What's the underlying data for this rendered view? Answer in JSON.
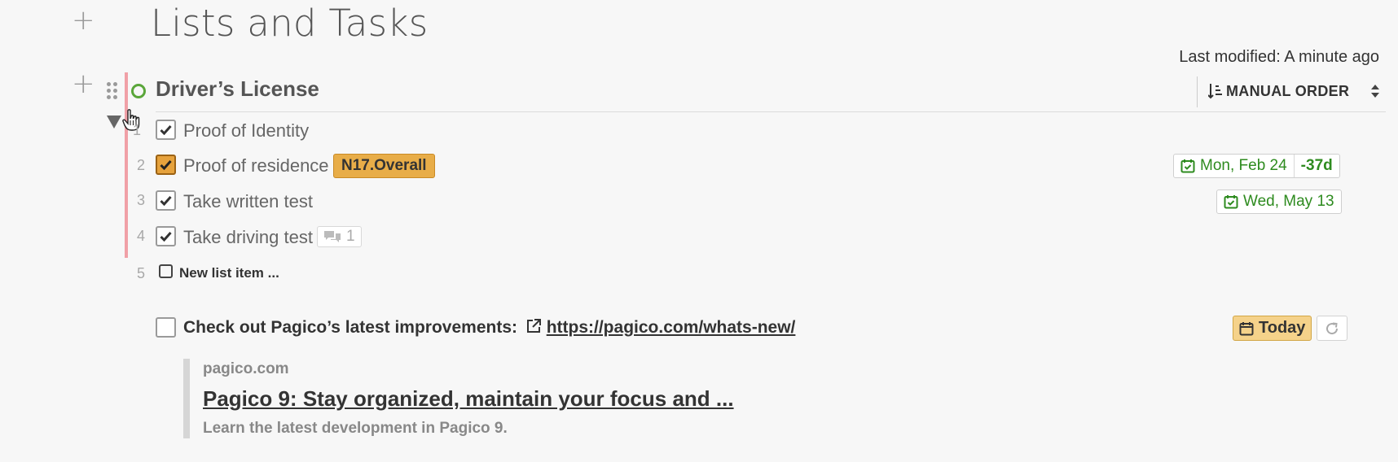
{
  "page": {
    "title": "Lists and Tasks",
    "last_modified": "Last modified: A minute ago"
  },
  "list": {
    "title": "Driver’s License",
    "sort_label": "MANUAL ORDER",
    "items": [
      {
        "num": "1",
        "text": "Proof of Identity",
        "checked": true
      },
      {
        "num": "2",
        "text": "Proof of residence",
        "checked": true,
        "tag": "N17.Overall",
        "date": "Mon, Feb 24",
        "days": "-37d"
      },
      {
        "num": "3",
        "text": "Take written test",
        "checked": true,
        "date": "Wed, May 13"
      },
      {
        "num": "4",
        "text": "Take driving test",
        "checked": true,
        "comments": "1"
      }
    ],
    "new_item": {
      "num": "5",
      "placeholder": "New list item ..."
    }
  },
  "task": {
    "text": "Check out Pagico’s latest improvements:",
    "link": "https://pagico.com/whats-new/",
    "due_label": "Today"
  },
  "preview": {
    "domain": "pagico.com",
    "title": "Pagico 9: Stay organized, maintain your focus and ...",
    "description": "Learn the latest development in Pagico 9."
  },
  "colors": {
    "accent_green": "#2e8b1f",
    "tag_orange": "#e8ad48",
    "today_yellow": "#f5d28a",
    "list_bar_red": "#f0a0a7"
  },
  "icons": [
    "plus-icon",
    "drag-handle-icon",
    "status-circle-icon",
    "sort-icon",
    "sort-arrows-icon",
    "collapse-triangle-icon",
    "hand-cursor-icon",
    "checkmark-icon",
    "comment-icon",
    "calendar-check-icon",
    "calendar-icon",
    "external-link-icon",
    "refresh-icon"
  ]
}
